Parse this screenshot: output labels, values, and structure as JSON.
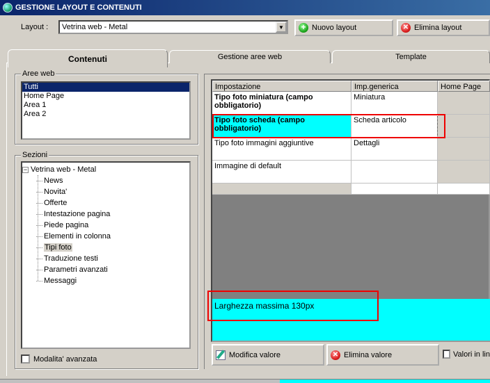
{
  "window": {
    "title": "GESTIONE LAYOUT E CONTENUTI"
  },
  "layout": {
    "label": "Layout :",
    "selected": "Vetrina web - Metal"
  },
  "toolbar": {
    "new_label": "Nuovo layout",
    "delete_label": "Elimina layout"
  },
  "tabs": [
    {
      "label": "Contenuti",
      "active": true
    },
    {
      "label": "Gestione aree web",
      "active": false
    },
    {
      "label": "Template",
      "active": false
    }
  ],
  "aree_web": {
    "title": "Aree web",
    "items": [
      {
        "label": "Tutti",
        "selected": true
      },
      {
        "label": "Home Page",
        "selected": false
      },
      {
        "label": "Area 1",
        "selected": false
      },
      {
        "label": "Area 2",
        "selected": false
      }
    ]
  },
  "sezioni": {
    "title": "Sezioni",
    "root": "Vetrina web - Metal",
    "expander": "⊟",
    "children": [
      "News",
      "Novita'",
      "Offerte",
      "Intestazione pagina",
      "Piede pagina",
      "Elementi in colonna",
      "Tipi foto",
      "Traduzione testi",
      "Parametri avanzati",
      "Messaggi"
    ],
    "selected": "Tipi foto"
  },
  "advanced": {
    "label": "Modalita' avanzata",
    "checked": false
  },
  "grid": {
    "columns": [
      "Impostazione",
      "Imp.generica",
      "Home Page"
    ],
    "rows": [
      {
        "name": "Tipo foto miniatura (campo obbligatorio)",
        "value": "Miniatura",
        "bold": true
      },
      {
        "name": "Tipo foto scheda (campo obbligatorio)",
        "value": "Scheda articolo",
        "bold": true,
        "highlight": true
      },
      {
        "name": "Tipo foto immagini aggiuntive",
        "value": "Dettagli",
        "bold": false
      },
      {
        "name": "Immagine di default",
        "value": "",
        "bold": false
      }
    ]
  },
  "description": {
    "text": "Larghezza massima 130px"
  },
  "actions": {
    "modify_label": "Modifica valore",
    "delete_label": "Elimina valore",
    "inline_label": "Valori in lin"
  },
  "colors": {
    "highlight": "#00ffff",
    "selection": "#0a246a",
    "callout": "#e00000"
  }
}
